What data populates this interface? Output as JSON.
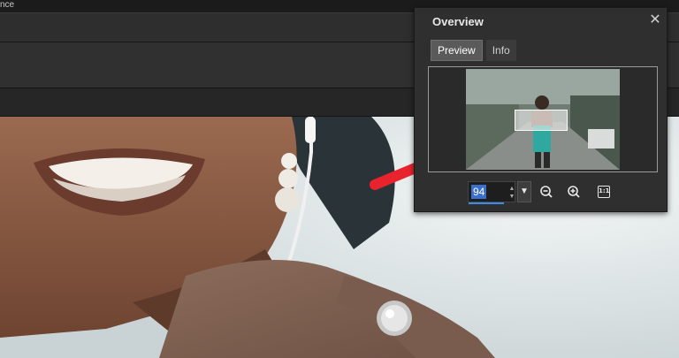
{
  "app": {
    "title_fragment": "nce"
  },
  "overview": {
    "title": "Overview",
    "close_glyph": "✕",
    "tabs": [
      {
        "label": "Preview",
        "active": true
      },
      {
        "label": "Info",
        "active": false
      }
    ],
    "zoom": {
      "value": "94",
      "zoom_out_icon": "zoom-out-icon",
      "zoom_in_icon": "zoom-in-icon",
      "actual_size_label": "1:1"
    }
  },
  "colors": {
    "panel_bg": "#2f2f2f",
    "tab_active": "#5a5a5a",
    "selection_blue": "#3a6fd0",
    "arrow_red": "#e8232d"
  }
}
